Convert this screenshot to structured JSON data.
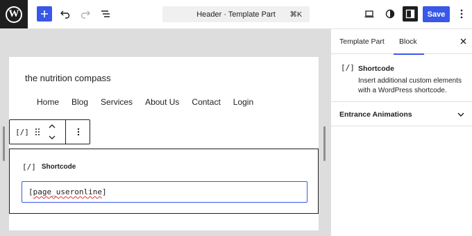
{
  "header": {
    "logo_glyph": "W",
    "command_title": "Header · Template Part",
    "shortcut": "⌘K",
    "save_label": "Save",
    "icons": [
      "wordpress-logo",
      "plus-icon",
      "undo-icon",
      "redo-icon",
      "list-view-icon",
      "desktop-preview-icon",
      "style-contrast-icon",
      "settings-sidebar-icon",
      "more-vertical-icon"
    ]
  },
  "canvas": {
    "site_title": "the nutrition compass",
    "nav_items": [
      "Home",
      "Blog",
      "Services",
      "About Us",
      "Contact",
      "Login"
    ],
    "toolbar": {
      "block_glyph": "[/]",
      "icons": [
        "shortcode-icon",
        "drag-handle-icon",
        "move-up-icon",
        "move-down-icon",
        "block-options-icon"
      ]
    },
    "shortcode_block": {
      "glyph": "[/]",
      "label": "Shortcode",
      "value_prefix": "[",
      "value_word": "page_useronline",
      "value_suffix": "]"
    }
  },
  "sidebar": {
    "tabs": [
      "Template Part",
      "Block"
    ],
    "active_tab": "Block",
    "block": {
      "glyph": "[/]",
      "name": "Shortcode",
      "description": "Insert additional custom elements with a WordPress shortcode."
    },
    "panels": [
      {
        "label": "Entrance Animations"
      }
    ]
  },
  "colors": {
    "accent": "#3858e9",
    "dark": "#1e1e1e",
    "canvas_bg": "#dddddd",
    "spell_error": "#d63638"
  }
}
